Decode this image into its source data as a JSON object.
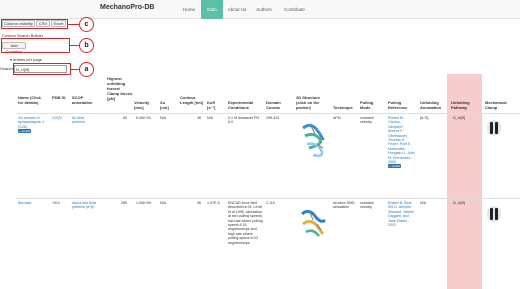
{
  "brand": "MechanoPro-DB",
  "nav": [
    "Home",
    "Data",
    "About Us",
    "Authors",
    "Contribute"
  ],
  "toolbar": {
    "column_visibility": "Column visibility",
    "csv": "CSV",
    "excel": "Excel"
  },
  "builder": {
    "title": "Custom Search Builder",
    "add_condition": "Add Condition"
  },
  "entries_label": "entries per page",
  "search": {
    "label": "Search:",
    "value": "N_U[Ø]"
  },
  "callouts": [
    "c",
    "b",
    "a"
  ],
  "headers": [
    "Name (Click for details)",
    "PDB ID",
    "SCOP annotation",
    "Highest unfolding forces/ Clamp forces [pN]",
    "Velocity [m/s]",
    "Xu [nm]",
    "Contour Length [nm]",
    "Koff [s⁻¹]",
    "Experimental Conditions",
    "Domain Coords",
    "3D Structure (click on the protein)",
    "Technique",
    "Pulling Mode",
    "Pulling Reference",
    "Unfolding Annotation",
    "Unfolding Pathway",
    "Mechanical Clamp"
  ],
  "rows": [
    {
      "name": "1st domain of synaptotagmin 1 (C2A)",
      "badge": "+ details",
      "pdb": "1DQV",
      "scop": "All beta proteins",
      "force": "60",
      "velocity": "6.00e+02",
      "xu": "N/A",
      "contour": "36",
      "koff": "N/A",
      "conditions": "0.1 M imidazole PH 6.0",
      "coords": "295-423",
      "technique": "AFM",
      "mode": "constant velocity",
      "reference": "Robert M. Carrion-Vazquez*, Andres F. Oberhauser, Thomas E. Fisher, Piotr E. Marszalek, Hongbin Li, Julio M. Fernandez - 2000",
      "ref_badge": "+ details",
      "annotation": "[A-G]",
      "pathway": "N_U[Ø]"
    },
    {
      "name": "Barnase",
      "pdb": "1BNI",
      "scop": "Alpha and beta proteins (α+β)",
      "force": "289",
      "velocity": "1.00e+09",
      "xu": "N/A",
      "contour": "36",
      "koff": "1.97E-5",
      "conditions": "ENCAD force field described in M. Levitt et al.1995, simulation at two pulling speeds: low rate where pulling speed=0.01 angstroms/ps and high rate where pulling speed=0.02 angstroms/ps",
      "coords": "2-110",
      "technique": "all atom SMD simulation",
      "mode": "constant velocity",
      "reference": "Robert B. Best, Shi Li, Armelle Steward, Valerie Daggett, and Jane Clarke - 2001",
      "annotation": "N/A",
      "pathway": "N_U[Ø]"
    }
  ],
  "colors": {
    "accent": "#5bc0a6",
    "callout": "#d6262a",
    "highlight": "#f7cccd",
    "link": "#2a7ab8"
  }
}
